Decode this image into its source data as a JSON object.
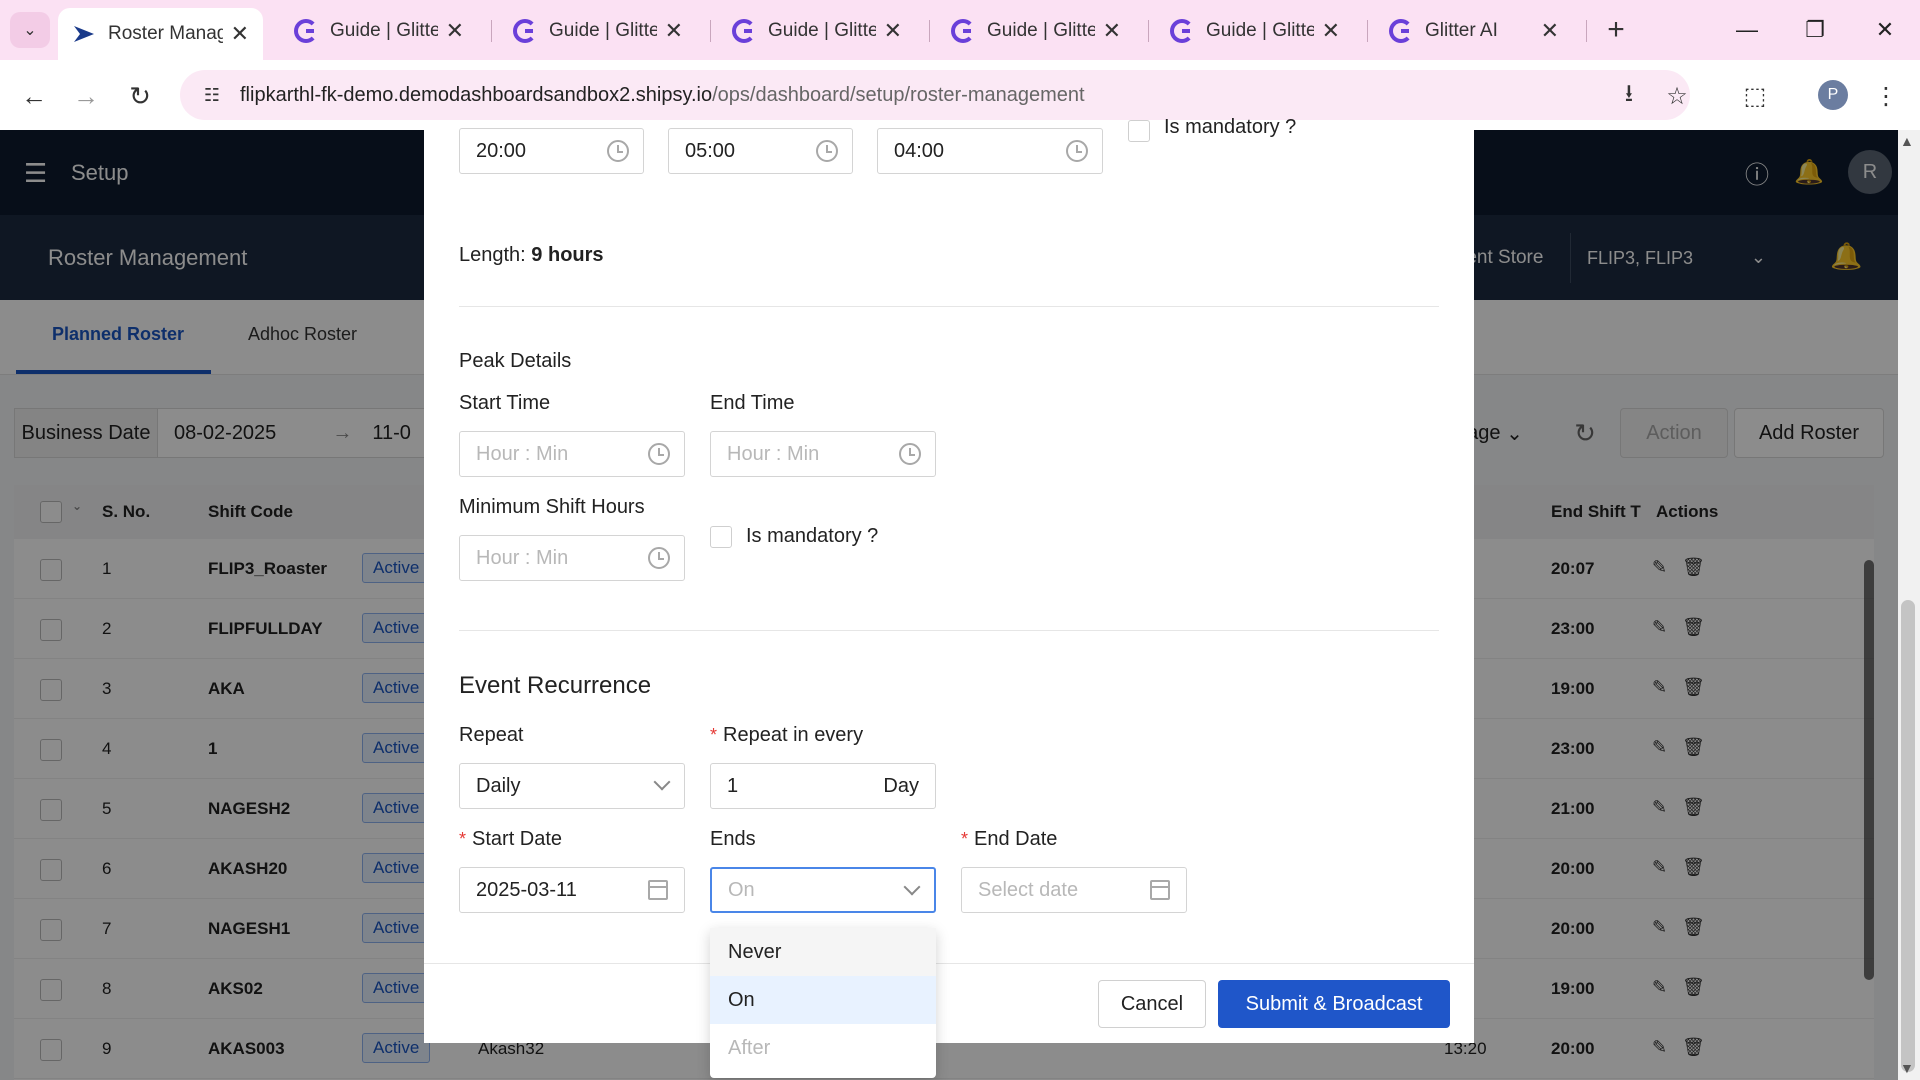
{
  "browser": {
    "tabs": [
      {
        "label": "Roster Manag",
        "active": true
      },
      {
        "label": "Guide | Glitter"
      },
      {
        "label": "Guide | Glitter"
      },
      {
        "label": "Guide | Glitter"
      },
      {
        "label": "Guide | Glitter"
      },
      {
        "label": "Guide | Glitter"
      },
      {
        "label": "Glitter AI"
      }
    ],
    "url_host": "flipkarthl-fk-demo.demodashboardsandbox2.shipsy.io",
    "url_path": "/ops/dashboard/setup/roster-management",
    "profile_initial": "P"
  },
  "app": {
    "header_title": "Setup",
    "avatar_initial": "R",
    "page_title": "Roster Management",
    "store_label": "rent Store",
    "store_value": "FLIP3, FLIP3",
    "tabs": [
      "Planned Roster",
      "Adhoc Roster"
    ],
    "filter": {
      "label": "Business Date",
      "start": "08-02-2025",
      "end": "11-0"
    },
    "controls": {
      "page_fragment": "age",
      "action": "Action",
      "add": "Add Roster"
    },
    "table": {
      "headers": {
        "sno": "S. No.",
        "shift_code": "Shift Code",
        "end_shift": "End Shift T",
        "actions": "Actions"
      },
      "rows": [
        {
          "sno": "1",
          "code": "FLIP3_Roaster",
          "status": "Active",
          "end": "20:07"
        },
        {
          "sno": "2",
          "code": "FLIPFULLDAY",
          "status": "Active",
          "end": "23:00"
        },
        {
          "sno": "3",
          "code": "AKA",
          "status": "Active",
          "end": "19:00"
        },
        {
          "sno": "4",
          "code": "1",
          "status": "Active",
          "end": "23:00"
        },
        {
          "sno": "5",
          "code": "NAGESH2",
          "status": "Active",
          "end": "21:00"
        },
        {
          "sno": "6",
          "code": "AKASH20",
          "status": "Active",
          "end": "20:00"
        },
        {
          "sno": "7",
          "code": "NAGESH1",
          "status": "Active",
          "end": "20:00"
        },
        {
          "sno": "8",
          "code": "AKS02",
          "status": "Active",
          "end": "19:00"
        },
        {
          "sno": "9",
          "code": "AKAS003",
          "status": "Active",
          "end": "20:00",
          "extra1": "Akash32",
          "extra2": "13:20"
        }
      ]
    }
  },
  "modal": {
    "times": {
      "start": "20:00",
      "end": "05:00",
      "min": "04:00"
    },
    "top_mandatory_label": "Is mandatory ?",
    "length_label": "Length:",
    "length_value": "9 hours",
    "peak": {
      "title": "Peak Details",
      "start_label": "Start Time",
      "end_label": "End Time",
      "min_label": "Minimum Shift Hours",
      "placeholder": "Hour : Min",
      "mandatory_label": "Is mandatory ?"
    },
    "recurrence": {
      "title": "Event Recurrence",
      "repeat_label": "Repeat",
      "repeat_value": "Daily",
      "repeat_every_label": "Repeat in every",
      "repeat_every_value": "1",
      "repeat_every_unit": "Day",
      "start_date_label": "Start Date",
      "start_date_value": "2025-03-11",
      "ends_label": "Ends",
      "ends_value": "On",
      "end_date_label": "End Date",
      "end_date_placeholder": "Select date"
    },
    "ends_options": [
      "Never",
      "On",
      "After"
    ],
    "cancel": "Cancel",
    "submit": "Submit & Broadcast"
  }
}
